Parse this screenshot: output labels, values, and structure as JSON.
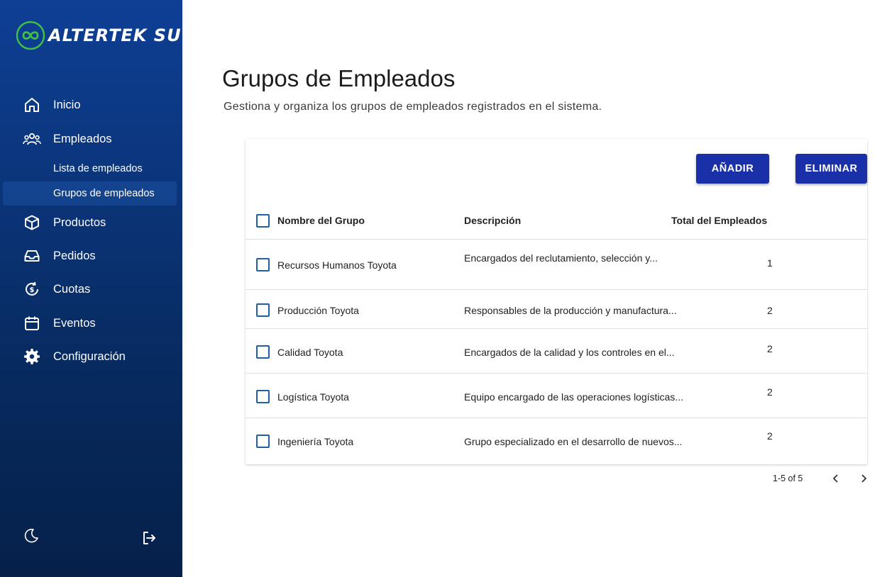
{
  "brand": {
    "name": "ALTERTEK SU"
  },
  "sidebar": {
    "items": [
      {
        "label": "Inicio",
        "icon": "home-icon"
      },
      {
        "label": "Empleados",
        "icon": "users-icon"
      },
      {
        "label": "Productos",
        "icon": "box-icon"
      },
      {
        "label": "Pedidos",
        "icon": "inbox-icon"
      },
      {
        "label": "Cuotas",
        "icon": "dollar-refresh-icon"
      },
      {
        "label": "Eventos",
        "icon": "calendar-icon"
      },
      {
        "label": "Configuración",
        "icon": "gear-icon"
      }
    ],
    "subitems": [
      {
        "label": "Lista de empleados"
      },
      {
        "label": "Grupos de empleados",
        "active": true
      }
    ],
    "bottom": {
      "theme_icon": "moon-icon",
      "logout_icon": "logout-icon"
    }
  },
  "header": {
    "title": "Grupos de Empleados",
    "subtitle": "Gestiona y organiza los grupos de empleados registrados en el sistema."
  },
  "toolbar": {
    "add_label": "AÑADIR",
    "delete_label": "ELIMINAR"
  },
  "table": {
    "columns": [
      "Nombre del Grupo",
      "Descripción",
      "Total del Empleados"
    ],
    "rows": [
      {
        "name": "Recursos Humanos Toyota",
        "description": "Encargados del reclutamiento, selección y...",
        "total": "1"
      },
      {
        "name": "Producción Toyota",
        "description": "Responsables de la producción y manufactura...",
        "total": "2"
      },
      {
        "name": "Calidad Toyota",
        "description": "Encargados de la calidad y los controles en el...",
        "total": "2"
      },
      {
        "name": "Logística Toyota",
        "description": "Equipo encargado de las operaciones logísticas...",
        "total": "2"
      },
      {
        "name": "Ingeniería Toyota",
        "description": "Grupo especializado en el desarrollo de nuevos...",
        "total": "2"
      }
    ]
  },
  "pagination": {
    "range": "1-5 of 5"
  },
  "colors": {
    "sidebar_top": "#0e3f95",
    "sidebar_bottom": "#06204a",
    "primary_button": "#1a30a8",
    "checkbox": "#1f5fa8",
    "logo_green": "#3fbf4a"
  }
}
